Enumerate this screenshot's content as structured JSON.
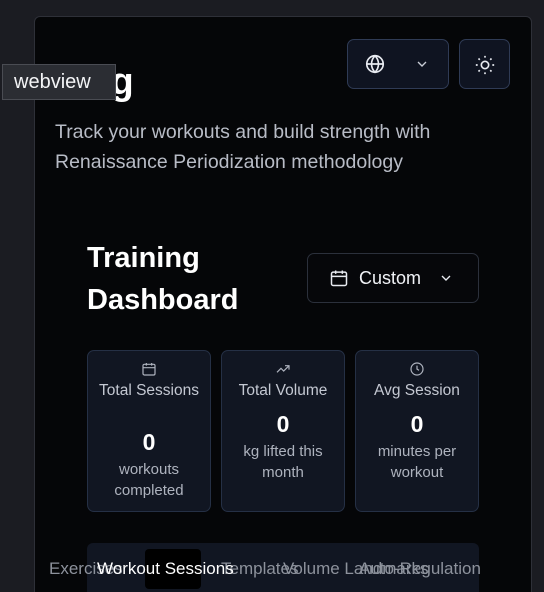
{
  "overlay": {
    "tag": "webview"
  },
  "header": {
    "title": "ning",
    "subtitle": "Track your workouts and build strength with Renaissance Periodization methodology"
  },
  "dashboard": {
    "title": "Training Dashboard",
    "range_label": "Custom"
  },
  "stats": [
    {
      "icon": "calendar-icon",
      "label": "Total Sessions",
      "value": "0",
      "desc": "workouts completed"
    },
    {
      "icon": "trending-up-icon",
      "label": "Total Volume",
      "value": "0",
      "desc": "kg lifted this month"
    },
    {
      "icon": "clock-icon",
      "label": "Avg Session",
      "value": "0",
      "desc": "minutes per workout"
    }
  ],
  "tabs": [
    {
      "label": "Exercises"
    },
    {
      "label": "Workout Sessions"
    },
    {
      "label": "Templates"
    },
    {
      "label": "Volume Landmarks"
    },
    {
      "label": "Auto-Regulation"
    }
  ],
  "colors": {
    "background": "#050608",
    "card": "#111622",
    "card_border": "#253045",
    "accent_border": "#2f3b55"
  }
}
